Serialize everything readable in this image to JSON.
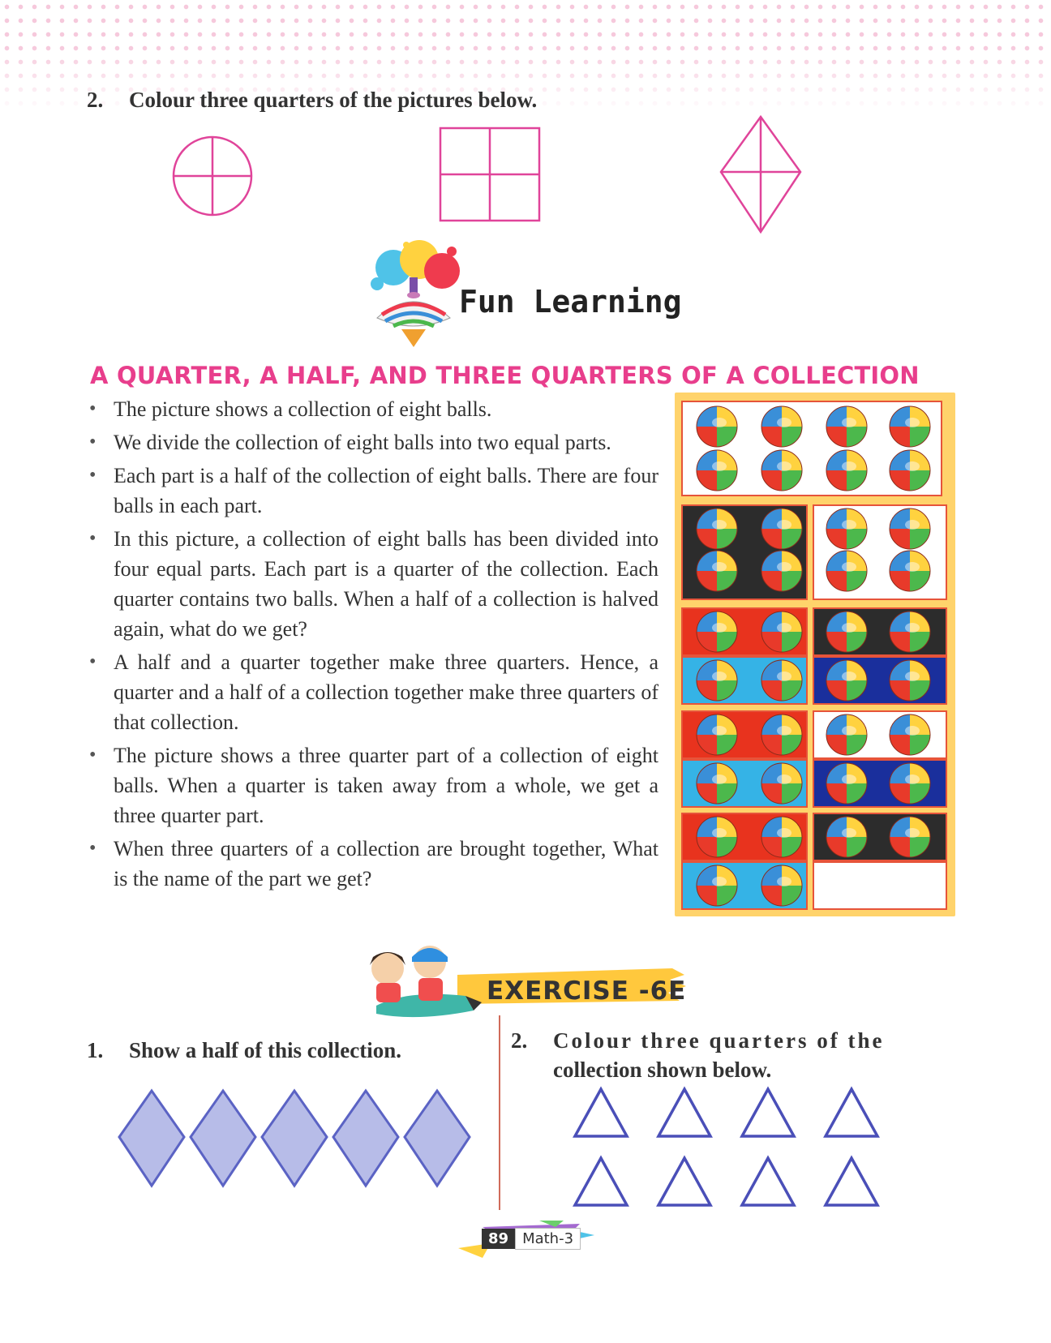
{
  "section1": {
    "number": "2.",
    "text": "Colour three quarters of the pictures below."
  },
  "fun_learning": {
    "title": "Fun Learning"
  },
  "collection": {
    "heading": "A QUARTER, A HALF, AND THREE QUARTERS OF A COLLECTION",
    "bullets": [
      "The picture shows a collection of eight balls.",
      "We divide the collection of eight balls into two equal parts.",
      "Each part is a half of the collection of eight balls. There are four balls in each part.",
      "In this picture, a collection of eight balls has been divided into four equal parts. Each part is a quarter of the collection. Each quarter contains two balls. When a half of a collection is halved again, what do we get?",
      "A half and a quarter together make three quarters. Hence, a quarter and a half of a collection together make three quarters of that collection.",
      "The picture shows a three quarter part of a collection of eight balls. When a quarter is taken away from a whole, we get a three quarter part.",
      "When three quarters of a collection are brought together, What is the name of the part we get?"
    ]
  },
  "exercise": {
    "label": "EXERCISE -6E",
    "q1_number": "1.",
    "q1_text": "Show a half of this collection.",
    "q2_number": "2.",
    "q2_line1": "Colour three quarters of the",
    "q2_line2": "collection shown below."
  },
  "footer": {
    "page_number": "89",
    "book": "Math-3"
  },
  "colors": {
    "shape_pink": "#e0449a",
    "heading_pink": "#e83e8c",
    "diamond_fill": "#b7bce8",
    "diamond_stroke": "#5b63c4",
    "triangle_stroke": "#4a4fb8"
  }
}
